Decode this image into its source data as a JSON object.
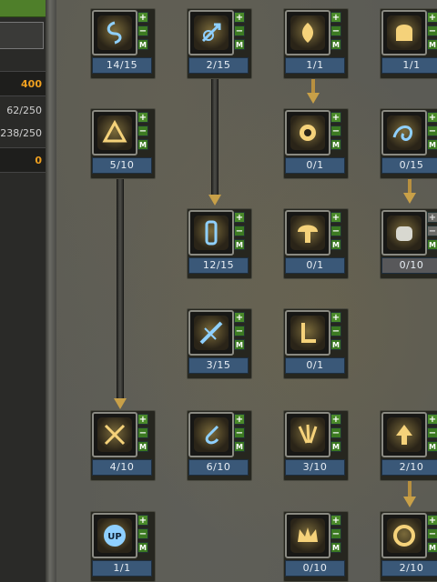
{
  "left_panel": {
    "value_top": "400",
    "stat1": "62/250",
    "stat2": "238/250",
    "value_bottom": "0"
  },
  "buttons": {
    "plus": "+",
    "minus": "−",
    "m": "M"
  },
  "skills": [
    {
      "id": "s1",
      "level": "14/15",
      "icon": "glyph-spiral-icon",
      "tone": "blue"
    },
    {
      "id": "s2",
      "level": "2/15",
      "icon": "sword-swirl-icon",
      "tone": "blue"
    },
    {
      "id": "s3",
      "level": "1/1",
      "icon": "flame-burst-icon",
      "tone": "gold"
    },
    {
      "id": "s4",
      "level": "1/1",
      "icon": "helmet-glow-icon",
      "tone": "gold"
    },
    {
      "id": "s5",
      "level": "5/10",
      "icon": "triangle-blade-icon",
      "tone": "gold"
    },
    {
      "id": "s6",
      "level": "0/1",
      "icon": "orb-burst-icon",
      "tone": "gold"
    },
    {
      "id": "s7",
      "level": "0/15",
      "icon": "wave-spiral-icon",
      "tone": "blue"
    },
    {
      "id": "s8",
      "level": "12/15",
      "icon": "pillar-glyph-icon",
      "tone": "blue"
    },
    {
      "id": "s9",
      "level": "0/1",
      "icon": "mushroom-glow-icon",
      "tone": "gold"
    },
    {
      "id": "s10",
      "level": "0/10",
      "icon": "fist-icon",
      "tone": "gray"
    },
    {
      "id": "s11",
      "level": "3/15",
      "icon": "blade-slash-icon",
      "tone": "blue"
    },
    {
      "id": "s12",
      "level": "0/1",
      "icon": "rune-l-icon",
      "tone": "gold"
    },
    {
      "id": "s13",
      "level": "4/10",
      "icon": "crossed-blade-icon",
      "tone": "gold"
    },
    {
      "id": "s14",
      "level": "6/10",
      "icon": "swirl-hook-icon",
      "tone": "blue"
    },
    {
      "id": "s15",
      "level": "3/10",
      "icon": "claw-icon",
      "tone": "gold"
    },
    {
      "id": "s16",
      "level": "2/10",
      "icon": "upgrade-arrow-icon",
      "tone": "gold"
    },
    {
      "id": "s17",
      "level": "1/1",
      "icon": "up-badge-icon",
      "tone": "blue"
    },
    {
      "id": "s18",
      "level": "0/10",
      "icon": "crown-blast-icon",
      "tone": "gold"
    },
    {
      "id": "s19",
      "level": "2/10",
      "icon": "ring-blast-icon",
      "tone": "gold"
    }
  ],
  "colors": {
    "gold": "#f5d27a",
    "blue": "#8fd0ff",
    "gray": "#d8d8d0"
  }
}
